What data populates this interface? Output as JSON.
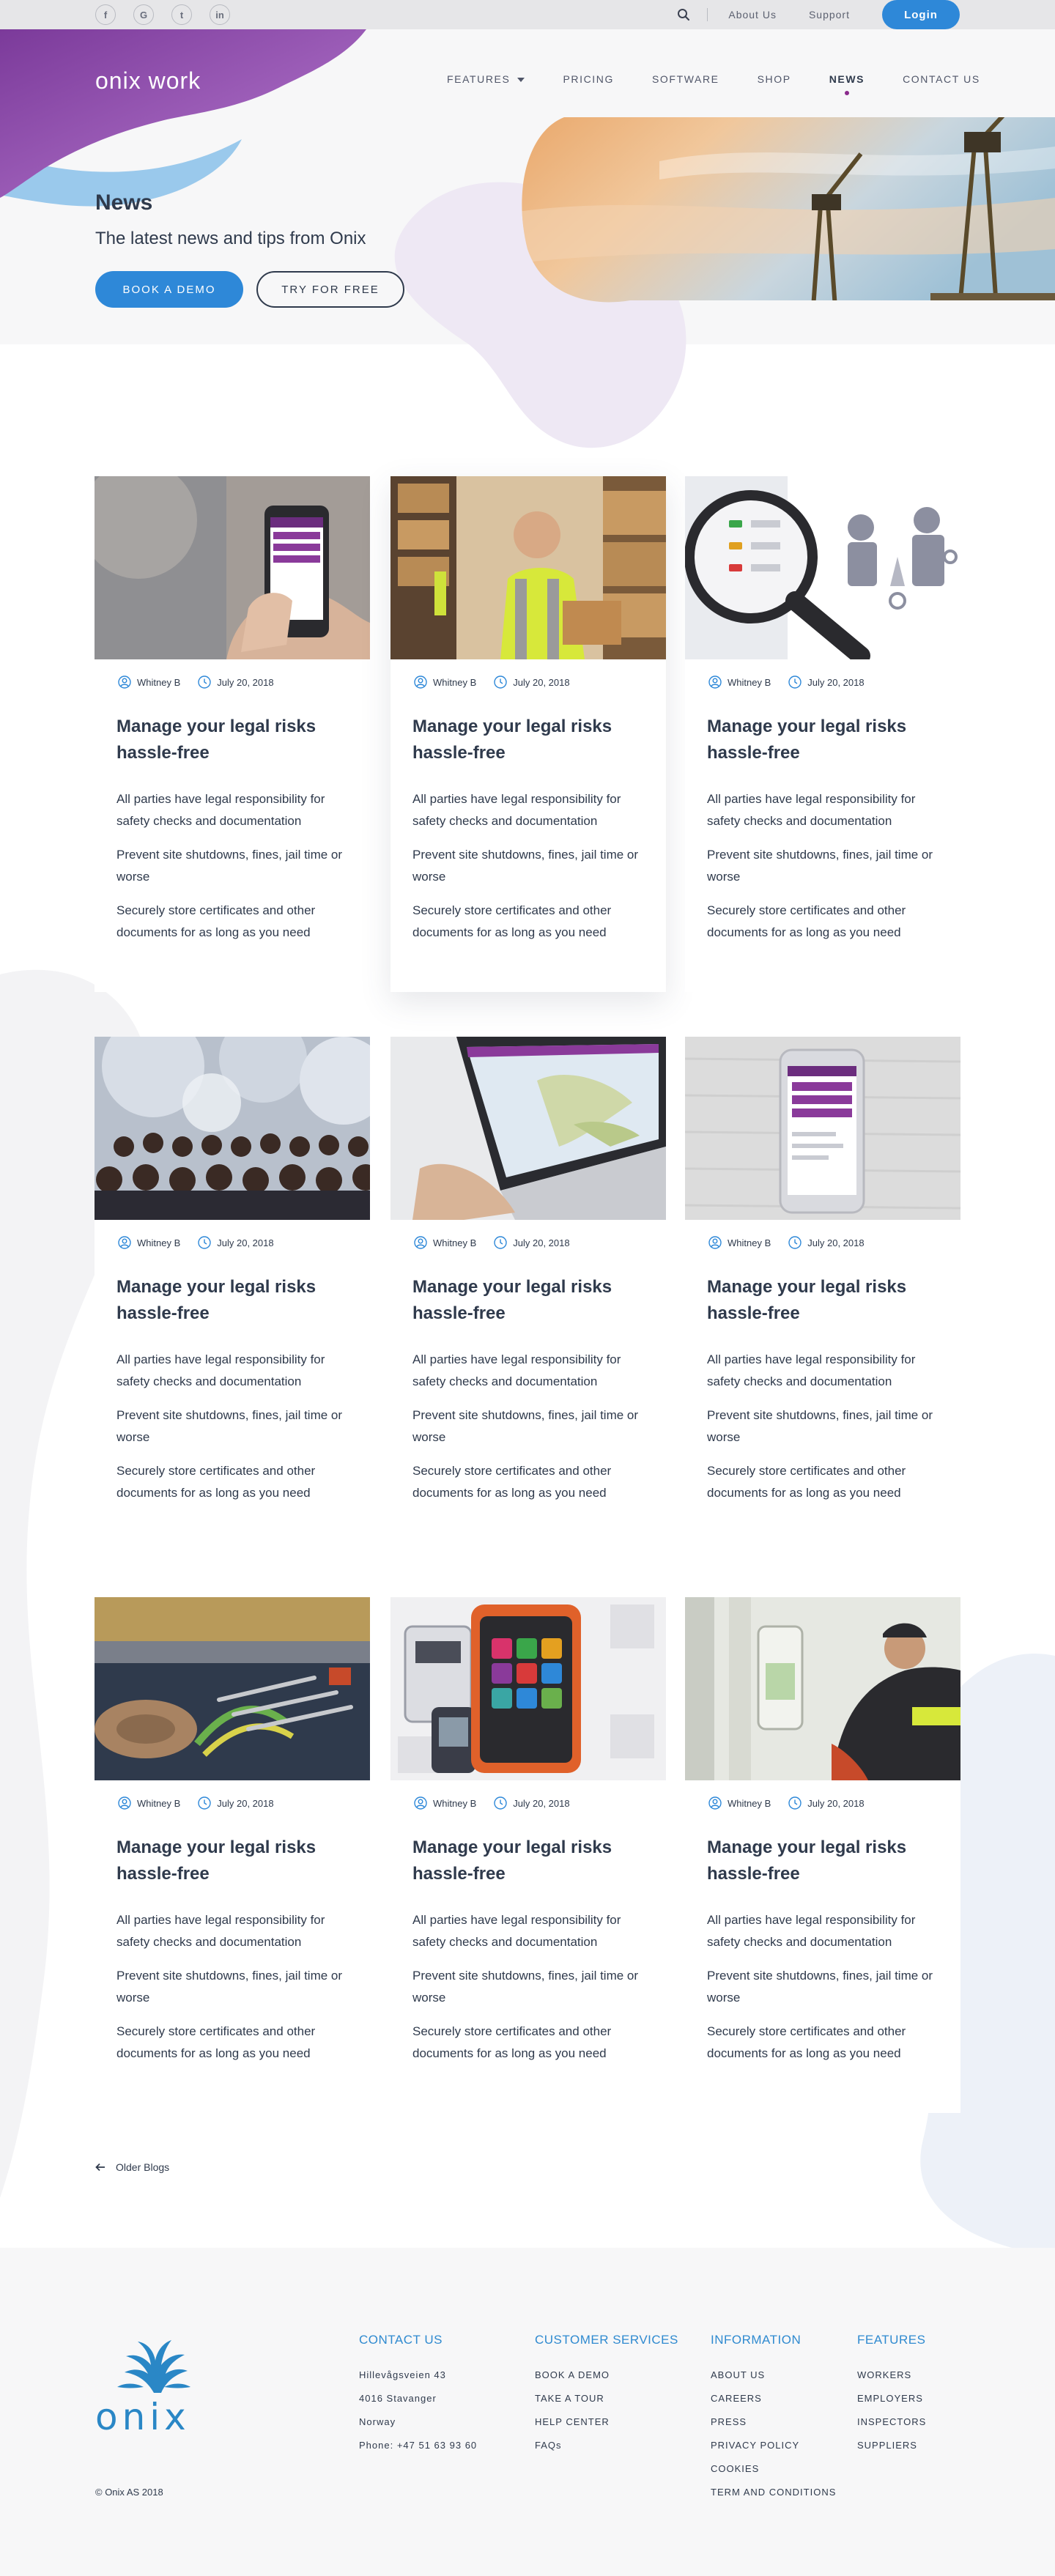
{
  "topbar": {
    "social": [
      {
        "icon": "facebook-icon",
        "glyph": "f"
      },
      {
        "icon": "google-icon",
        "glyph": "G"
      },
      {
        "icon": "twitter-icon",
        "glyph": "t"
      },
      {
        "icon": "linkedin-icon",
        "glyph": "in"
      }
    ],
    "links": [
      "About Us",
      "Support"
    ],
    "login_label": "Login"
  },
  "header": {
    "logo_part1": "onix",
    "logo_part2": "work",
    "nav": [
      "FEATURES",
      "PRICING",
      "SOFTWARE",
      "SHOP",
      "NEWS",
      "CONTACT US"
    ],
    "active_nav": "NEWS"
  },
  "hero": {
    "title": "News",
    "subtitle": "The latest news and tips from Onix",
    "demo_label": "BOOK A DEMO",
    "try_label": "TRY FOR FREE"
  },
  "posts": [
    {
      "image": "hand-phone-image",
      "author": "Whitney B",
      "date": "July 20, 2018",
      "title": "Manage your legal risks hassle-free",
      "p1": "All parties have legal responsibility for safety checks and documentation",
      "p2": "Prevent site shutdowns, fines, jail time or worse",
      "p3": "Securely store certificates and other documents for as long as you need"
    },
    {
      "image": "warehouse-worker-image",
      "author": "Whitney B",
      "date": "July 20, 2018",
      "title": "Manage your legal risks hassle-free",
      "p1": "All parties have legal responsibility for safety checks and documentation",
      "p2": "Prevent site shutdowns, fines, jail time or worse",
      "p3": "Securely store certificates and other documents for as long as you need"
    },
    {
      "image": "magnifier-illustration-image",
      "author": "Whitney B",
      "date": "July 20, 2018",
      "title": "Manage your legal risks hassle-free",
      "p1": "All parties have legal responsibility for safety checks and documentation",
      "p2": "Prevent site shutdowns, fines, jail time or worse",
      "p3": "Securely store certificates and other documents for as long as you need"
    },
    {
      "image": "conference-audience-image",
      "author": "Whitney B",
      "date": "July 20, 2018",
      "title": "Manage your legal risks hassle-free",
      "p1": "All parties have legal responsibility for safety checks and documentation",
      "p2": "Prevent site shutdowns, fines, jail time or worse",
      "p3": "Securely store certificates and other documents for as long as you need"
    },
    {
      "image": "laptop-map-image",
      "author": "Whitney B",
      "date": "July 20, 2018",
      "title": "Manage your legal risks hassle-free",
      "p1": "All parties have legal responsibility for safety checks and documentation",
      "p2": "Prevent site shutdowns, fines, jail time or worse",
      "p3": "Securely store certificates and other documents for as long as you need"
    },
    {
      "image": "phone-on-wood-image",
      "author": "Whitney B",
      "date": "July 20, 2018",
      "title": "Manage your legal risks hassle-free",
      "p1": "All parties have legal responsibility for safety checks and documentation",
      "p2": "Prevent site shutdowns, fines, jail time or worse",
      "p3": "Securely store certificates and other documents for as long as you need"
    },
    {
      "image": "tools-slings-image",
      "author": "Whitney B",
      "date": "July 20, 2018",
      "title": "Manage your legal risks hassle-free",
      "p1": "All parties have legal responsibility for safety checks and documentation",
      "p2": "Prevent site shutdowns, fines, jail time or worse",
      "p3": "Securely store certificates and other documents for as long as you need"
    },
    {
      "image": "rugged-devices-image",
      "author": "Whitney B",
      "date": "July 20, 2018",
      "title": "Manage your legal risks hassle-free",
      "p1": "All parties have legal responsibility for safety checks and documentation",
      "p2": "Prevent site shutdowns, fines, jail time or worse",
      "p3": "Securely store certificates and other documents for as long as you need"
    },
    {
      "image": "inspector-pipes-image",
      "author": "Whitney B",
      "date": "July 20, 2018",
      "title": "Manage your legal risks hassle-free",
      "p1": "All parties have legal responsibility for safety checks and documentation",
      "p2": "Prevent site shutdowns, fines, jail time or worse",
      "p3": "Securely store certificates and other documents for as long as you need"
    }
  ],
  "older_label": "Older Blogs",
  "footer": {
    "logo_word": "onix",
    "copyright": "© Onix AS 2018",
    "contact": {
      "heading": "CONTACT US",
      "lines": [
        "Hillevågsveien 43",
        "4016 Stavanger",
        "Norway",
        "Phone: +47 51 63 93 60"
      ]
    },
    "customer": {
      "heading": "CUSTOMER SERVICES",
      "links": [
        "BOOK A DEMO",
        "TAKE A TOUR",
        "HELP CENTER",
        "FAQs"
      ]
    },
    "information": {
      "heading": "INFORMATION",
      "links": [
        "ABOUT US",
        "CAREERS",
        "PRESS",
        "PRIVACY POLICY",
        "COOKIES",
        "TERM AND CONDITIONS"
      ]
    },
    "features": {
      "heading": "FEATURES",
      "links": [
        "WORKERS",
        "EMPLOYERS",
        "INSPECTORS",
        "SUPPLIERS"
      ]
    }
  },
  "colors": {
    "accent": "#2e88d8",
    "brand_purple": "#8a2a8c",
    "text": "#2f3a4c",
    "footer_heading": "#2f8ad0"
  }
}
